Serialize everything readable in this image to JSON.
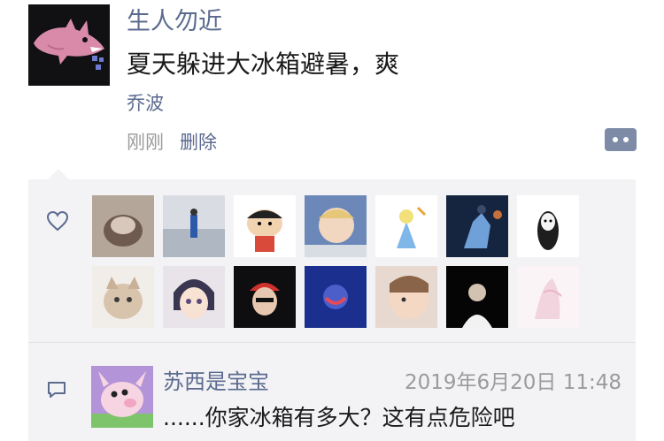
{
  "post": {
    "author": "生人勿近",
    "content": "夏天躲进大冰箱避暑，爽",
    "location": "乔波",
    "time": "刚刚",
    "delete_label": "删除"
  },
  "icons": {
    "avatar": "shark-avatar",
    "action": "more-dots-icon",
    "like": "heart-icon",
    "comment": "comment-icon"
  },
  "likes": {
    "count": 14,
    "avatars": [
      "liker-1",
      "liker-2",
      "liker-3",
      "liker-4",
      "liker-5",
      "liker-6",
      "liker-7",
      "liker-8",
      "liker-9",
      "liker-10",
      "liker-11",
      "liker-12",
      "liker-13",
      "liker-14"
    ]
  },
  "comments": [
    {
      "name": "苏西是宝宝",
      "time": "2019年6月20日 11:48",
      "text": "......你家冰箱有多大？这有点危险吧"
    }
  ],
  "colors": {
    "link": "#5b6a8f",
    "muted": "#9b9b9b",
    "panel": "#f3f3f5",
    "action_button": "#7d8ba6"
  }
}
